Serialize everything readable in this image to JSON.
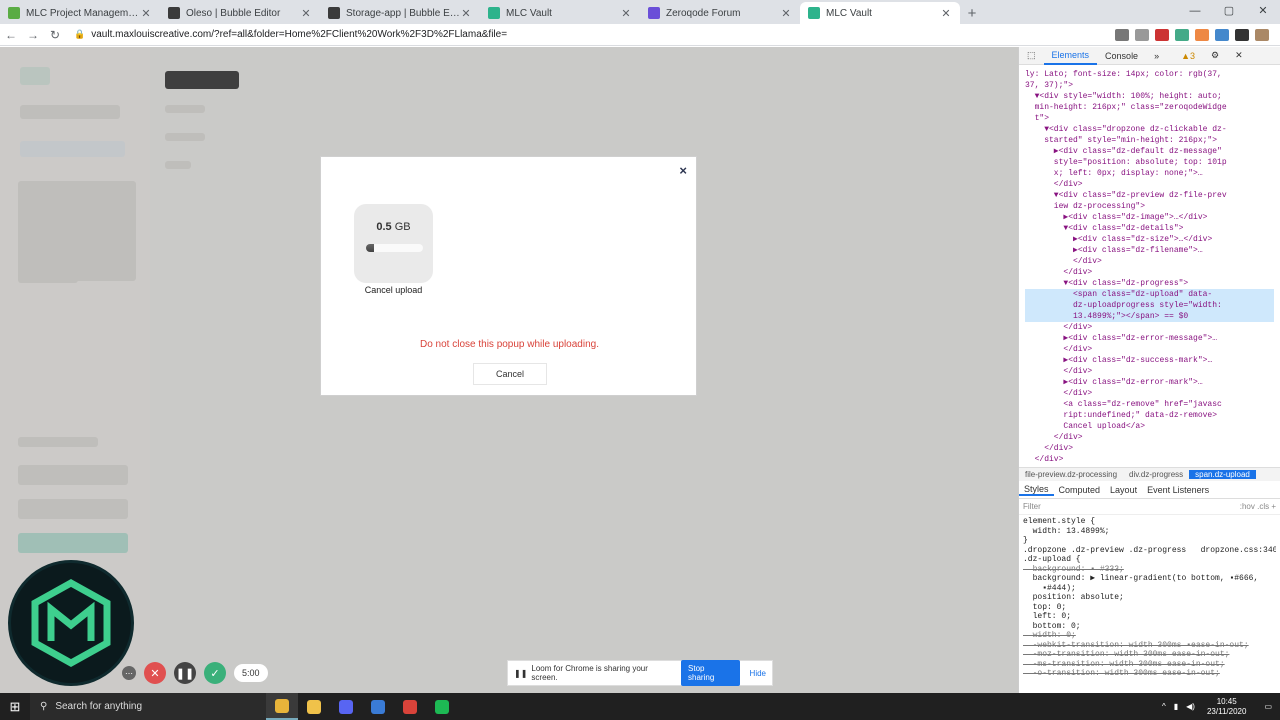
{
  "browser": {
    "tabs": [
      {
        "label": "MLC Project Management | Trello",
        "color": "#5aac44"
      },
      {
        "label": "Oleso | Bubble Editor",
        "color": "#3b3b3b"
      },
      {
        "label": "Storage-app | Bubble Editor",
        "color": "#3b3b3b"
      },
      {
        "label": "MLC Vault",
        "color": "#2db38c"
      },
      {
        "label": "Zeroqode Forum",
        "color": "#6a4fd8"
      },
      {
        "label": "MLC Vault",
        "color": "#2db38c",
        "active": true
      }
    ],
    "new_tab": "+",
    "window_controls": [
      "—",
      "▢",
      "✕"
    ],
    "url": "vault.maxlouiscreative.com/?ref=all&folder=Home%2FClient%20Work%2F3D%2FLlama&file="
  },
  "modal": {
    "size_value": "0.5",
    "size_unit": "GB",
    "progress_percent": 13.4899,
    "cancel_upload_label": "Cancel upload",
    "warning": "Do not close this popup while uploading.",
    "cancel_label": "Cancel",
    "close_glyph": "×"
  },
  "devtools": {
    "tabs": [
      "Elements",
      "Console"
    ],
    "badge": "▲3",
    "dom_lines": [
      "ly: Lato; font-size: 14px; color: rgb(37,",
      "37, 37);\">",
      "  ▼<div style=\"width: 100%; height: auto;",
      "  min-height: 216px;\" class=\"zeroqodeWidge",
      "  t\">",
      "    ▼<div class=\"dropzone dz-clickable dz-",
      "    started\" style=\"min-height: 216px;\">",
      "      ▶<div class=\"dz-default dz-message\"",
      "      style=\"position: absolute; top: 101p",
      "      x; left: 0px; display: none;\">…",
      "      </div>",
      "      ▼<div class=\"dz-preview dz-file-prev",
      "      iew dz-processing\">",
      "        ▶<div class=\"dz-image\">…</div>",
      "        ▼<div class=\"dz-details\">",
      "          ▶<div class=\"dz-size\">…</div>",
      "          ▶<div class=\"dz-filename\">…",
      "          </div>",
      "        </div>",
      "        ▼<div class=\"dz-progress\">",
      "          <span class=\"dz-upload\" data-",
      "          dz-uploadprogress style=\"width:",
      "          13.4899%;\"></span> == $0",
      "        </div>",
      "        ▶<div class=\"dz-error-message\">…",
      "        </div>",
      "        ▶<div class=\"dz-success-mark\">…",
      "        </div>",
      "        ▶<div class=\"dz-error-mark\">…",
      "        </div>",
      "        <a class=\"dz-remove\" href=\"javasc",
      "        ript:undefined;\" data-dz-remove>",
      "        Cancel upload</a>",
      "      </div>",
      "    </div>",
      "  </div>"
    ],
    "breadcrumbs": [
      "file-preview.dz-processing",
      "div.dz-progress",
      "span.dz-upload"
    ],
    "style_tabs": [
      "Styles",
      "Computed",
      "Layout",
      "Event Listeners"
    ],
    "filter_placeholder": "Filter",
    "filter_right": ":hov .cls +",
    "css_lines": [
      {
        "text": "element.style {",
        "strike": false
      },
      {
        "text": "  width: 13.4899%;",
        "strike": false
      },
      {
        "text": "}",
        "strike": false
      },
      {
        "text": ".dropzone .dz-preview .dz-progress   dropzone.css:340",
        "strike": false
      },
      {
        "text": ".dz-upload {",
        "strike": false
      },
      {
        "text": "  background: ▪ #333;",
        "strike": true
      },
      {
        "text": "  background: ▶ linear-gradient(to bottom, ▪#666,",
        "strike": false
      },
      {
        "text": "    ▪#444);",
        "strike": false
      },
      {
        "text": "  position: absolute;",
        "strike": false
      },
      {
        "text": "  top: 0;",
        "strike": false
      },
      {
        "text": "  left: 0;",
        "strike": false
      },
      {
        "text": "  bottom: 0;",
        "strike": false
      },
      {
        "text": "  width: 0;",
        "strike": true
      },
      {
        "text": "  -webkit-transition: width 300ms ▪ease-in-out;",
        "strike": true
      },
      {
        "text": "  -moz-transition: width 300ms ease-in-out;",
        "strike": true
      },
      {
        "text": "  -ms-transition: width 300ms ease-in-out;",
        "strike": true
      },
      {
        "text": "  -o-transition: width 300ms ease-in-out;",
        "strike": true
      }
    ]
  },
  "recorder": {
    "timer": "5:00"
  },
  "sharebar": {
    "message": "Loom for Chrome is sharing your screen.",
    "stop_label": "Stop sharing",
    "hide_label": "Hide"
  },
  "taskbar": {
    "search_placeholder": "Search for anything",
    "apps": [
      {
        "name": "chrome",
        "color": "#e8b43a"
      },
      {
        "name": "explorer",
        "color": "#f0c24a"
      },
      {
        "name": "discord",
        "color": "#5865f2"
      },
      {
        "name": "blender",
        "color": "#3a7bd5"
      },
      {
        "name": "gmail",
        "color": "#d9433a"
      },
      {
        "name": "spotify",
        "color": "#1db954"
      }
    ],
    "time": "10:45",
    "date": "23/11/2020"
  }
}
